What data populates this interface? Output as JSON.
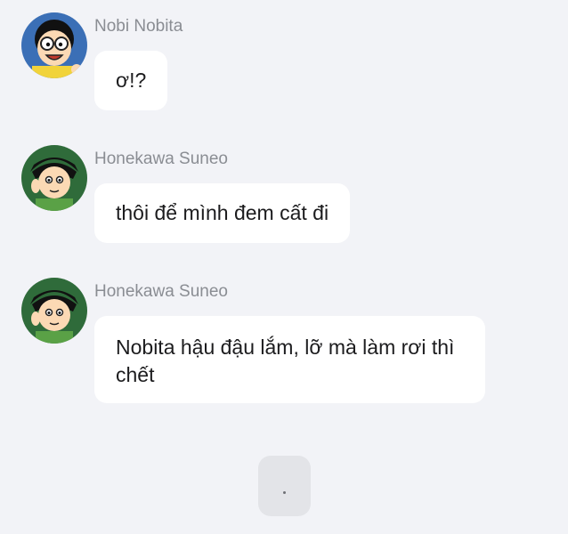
{
  "messages": [
    {
      "sender": "Nobi Nobita",
      "text": "ơ!?",
      "avatar_icon": "nobita-avatar"
    },
    {
      "sender": "Honekawa Suneo",
      "text": "thôi để mình đem cất đi",
      "avatar_icon": "suneo-avatar"
    },
    {
      "sender": "Honekawa Suneo",
      "text": "Nobita hậu đậu lắm, lỡ mà làm rơi thì chết",
      "avatar_icon": "suneo-avatar"
    }
  ],
  "typing": {
    "text": "."
  },
  "colors": {
    "background": "#f2f3f7",
    "bubble": "#ffffff",
    "sender": "#8a8d93",
    "message_text": "#1c1c1e",
    "typing_bubble": "#e3e4e8"
  }
}
